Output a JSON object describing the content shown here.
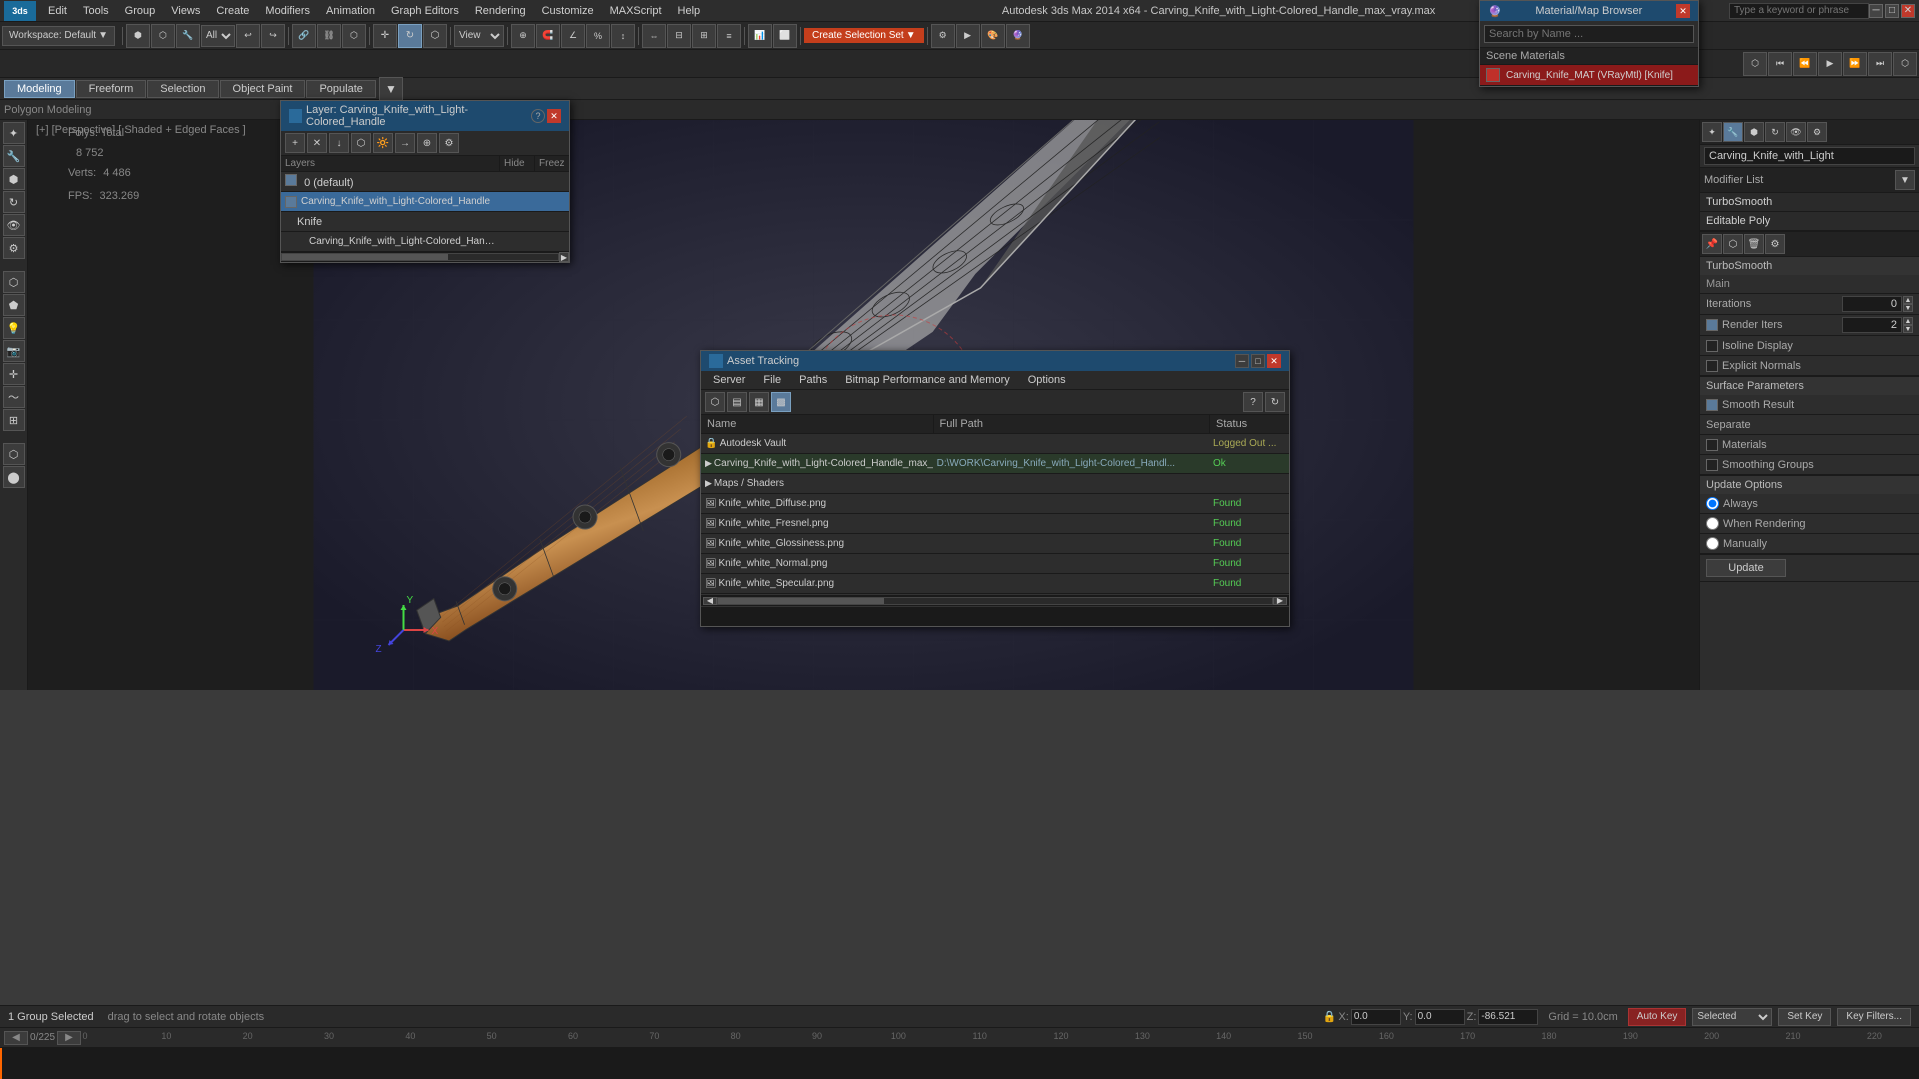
{
  "app": {
    "title": "Autodesk 3ds Max 2014 x64 - Carving_Knife_with_Light-Colored_Handle_max_vray.max",
    "logo": "3ds",
    "workspace": "Workspace: Default"
  },
  "menu": {
    "items": [
      "Edit",
      "Tools",
      "Group",
      "Views",
      "Create",
      "Modifiers",
      "Animation",
      "Graph Editors",
      "Rendering",
      "Customize",
      "MAXScript",
      "Help"
    ]
  },
  "toolbar": {
    "select_label": "All",
    "view_label": "View",
    "create_selection": "Create Selection Set"
  },
  "mode_tabs": {
    "tabs": [
      "Modeling",
      "Freeform",
      "Selection",
      "Object Paint",
      "Populate"
    ]
  },
  "current_mode": "Polygon Modeling",
  "viewport": {
    "label": "[+] [Perspective] [ Shaded + Edged Faces ]"
  },
  "stats": {
    "polys_label": "Polys:",
    "polys_total": "Total",
    "polys_value": "8 752",
    "verts_label": "Verts:",
    "verts_value": "4 486",
    "fps_label": "FPS:",
    "fps_value": "323.269"
  },
  "layer_dialog": {
    "title": "Layer: Carving_Knife_with_Light-Colored_Handle",
    "columns": {
      "layers": "Layers",
      "hide": "Hide",
      "freeze": "Freez"
    },
    "items": [
      {
        "id": "0",
        "name": "0 (default)",
        "indent": 0,
        "selected": false,
        "checked": true
      },
      {
        "id": "1",
        "name": "Carving_Knife_with_Light-Colored_Handle",
        "indent": 0,
        "selected": true,
        "checked": true
      },
      {
        "id": "2",
        "name": "Knife",
        "indent": 1,
        "selected": false,
        "checked": false
      },
      {
        "id": "3",
        "name": "Carving_Knife_with_Light-Colored_Handle",
        "indent": 2,
        "selected": false,
        "checked": false
      }
    ]
  },
  "material_browser": {
    "title": "Material/Map Browser",
    "search_placeholder": "Search by Name ...",
    "scene_materials_label": "Scene Materials",
    "items": [
      {
        "id": "1",
        "name": "Carving_Knife_MAT (VRayMtl) [Knife]",
        "color": "#c0302a"
      }
    ]
  },
  "properties_panel": {
    "modifier_list_label": "Modifier List",
    "modifiers": [
      {
        "name": "TurboSmooth",
        "selected": false
      },
      {
        "name": "Editable Poly",
        "selected": false
      }
    ],
    "turbosmooth": {
      "title": "TurboSmooth",
      "main_label": "Main",
      "iterations_label": "Iterations",
      "iterations_value": "0",
      "render_iters_label": "Render Iters",
      "render_iters_value": "2",
      "isoline_display": "Isoline Display",
      "explicit_normals": "Explicit Normals",
      "surface_params_label": "Surface Parameters",
      "smooth_result": "Smooth Result",
      "separate_label": "Separate",
      "materials": "Materials",
      "smoothing_groups": "Smoothing Groups",
      "update_options_label": "Update Options",
      "always": "Always",
      "when_rendering": "When Rendering",
      "manually": "Manually",
      "update_btn": "Update"
    }
  },
  "asset_tracking": {
    "title": "Asset Tracking",
    "menu_items": [
      "Server",
      "File",
      "Paths",
      "Bitmap Performance and Memory",
      "Options"
    ],
    "columns": {
      "name": "Name",
      "full_path": "Full Path",
      "status": "Status"
    },
    "rows": [
      {
        "id": "0",
        "name": "Autodesk Vault",
        "path": "",
        "status": "Logged Out ...",
        "indent": 0
      },
      {
        "id": "1",
        "name": "Carving_Knife_with_Light-Colored_Handle_max_vray.max",
        "path": "D:\\WORK\\Carving_Knife_with_Light-Colored_Handl...",
        "status": "Ok",
        "indent": 1
      },
      {
        "id": "2",
        "name": "Maps / Shaders",
        "path": "",
        "status": "",
        "indent": 2
      },
      {
        "id": "3",
        "name": "Knife_white_Diffuse.png",
        "path": "",
        "status": "Found",
        "indent": 3
      },
      {
        "id": "4",
        "name": "Knife_white_Fresnel.png",
        "path": "",
        "status": "Found",
        "indent": 3
      },
      {
        "id": "5",
        "name": "Knife_white_Glossiness.png",
        "path": "",
        "status": "Found",
        "indent": 3
      },
      {
        "id": "6",
        "name": "Knife_white_Normal.png",
        "path": "",
        "status": "Found",
        "indent": 3
      },
      {
        "id": "7",
        "name": "Knife_white_Specular.png",
        "path": "",
        "status": "Found",
        "indent": 3
      }
    ]
  },
  "status_bar": {
    "group_selected": "1 Group Selected",
    "hint": "drag to select and rotate objects",
    "x_label": "X:",
    "x_value": "0.0",
    "y_label": "Y:",
    "y_value": "0.0",
    "z_label": "Z:",
    "z_value": "-86.521",
    "grid_label": "Grid = 10.0cm",
    "auto_key": "Auto Key",
    "selected_label": "Selected",
    "set_key": "Set Key",
    "key_filters": "Key Filters..."
  },
  "timeline": {
    "frame_current": "0",
    "frame_total": "225",
    "ticks": [
      0,
      10,
      20,
      30,
      40,
      50,
      60,
      70,
      80,
      90,
      100,
      110,
      120,
      130,
      140,
      150,
      160,
      170,
      180,
      190,
      200,
      210,
      220
    ]
  },
  "icons": {
    "close": "✕",
    "minimize": "─",
    "maximize": "□",
    "arrow_right": "▶",
    "arrow_down": "▼",
    "arrow_left": "◀",
    "check": "✓",
    "folder": "📁",
    "file": "📄",
    "help": "?",
    "lock": "🔒",
    "search": "🔍"
  }
}
